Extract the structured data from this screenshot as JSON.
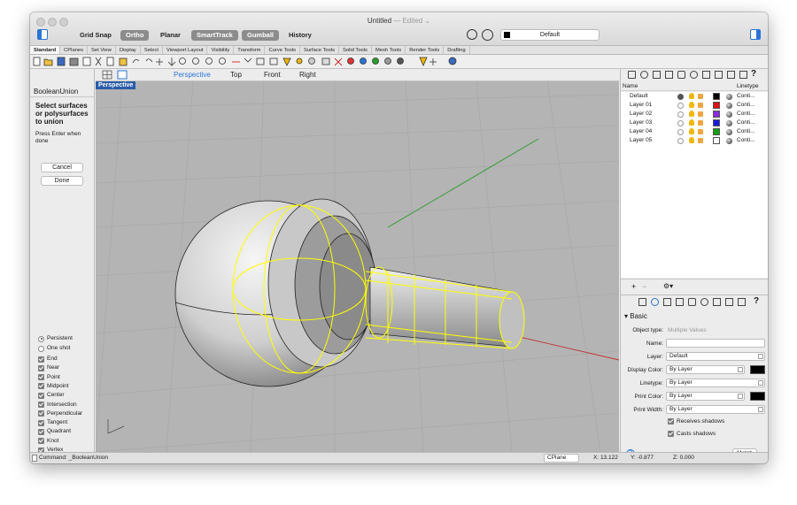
{
  "window": {
    "title": "Untitled",
    "edited": "— Edited ⌄"
  },
  "toolbar": {
    "grid_snap": "Grid Snap",
    "ortho": "Ortho",
    "planar": "Planar",
    "smarttrack": "SmartTrack",
    "gumball": "Gumball",
    "history": "History",
    "current_layer": "Default"
  },
  "tabs": [
    "Standard",
    "CPlanes",
    "Set View",
    "Display",
    "Select",
    "Viewport Layout",
    "Visibility",
    "Transform",
    "Curve Tools",
    "Surface Tools",
    "Solid Tools",
    "Mesh Tools",
    "Render Tools",
    "Drafting"
  ],
  "command_panel": {
    "name": "BooleanUnion",
    "prompt": "Select surfaces or polysurfaces to union",
    "hint": "Press Enter when done",
    "cancel": "Cancel",
    "done": "Done"
  },
  "osnap": {
    "persistent": "Persistent",
    "one_shot": "One shot",
    "items": [
      "End",
      "Near",
      "Point",
      "Midpoint",
      "Center",
      "Intersection",
      "Perpendicular",
      "Tangent",
      "Quadrant",
      "Knot",
      "Vertex"
    ]
  },
  "viewports": {
    "tabs": [
      "Perspective",
      "Top",
      "Front",
      "Right"
    ],
    "active_label": "Perspective"
  },
  "layers": {
    "col_name": "Name",
    "col_linetype": "Linetype",
    "rows": [
      {
        "name": "Default",
        "color": "#000000",
        "linetype": "Conti..."
      },
      {
        "name": "Layer 01",
        "color": "#e01010",
        "linetype": "Conti..."
      },
      {
        "name": "Layer 02",
        "color": "#8a2be2",
        "linetype": "Conti..."
      },
      {
        "name": "Layer 03",
        "color": "#1a1adc",
        "linetype": "Conti..."
      },
      {
        "name": "Layer 04",
        "color": "#10a010",
        "linetype": "Conti..."
      },
      {
        "name": "Layer 05",
        "color": "#ffffff",
        "linetype": "Conti..."
      }
    ]
  },
  "properties": {
    "section": "Basic",
    "object_type_label": "Object type:",
    "object_type_value": "Multiple Values",
    "name_label": "Name:",
    "layer_label": "Layer:",
    "layer_value": "Default",
    "display_color_label": "Display Color:",
    "display_color_value": "By Layer",
    "linetype_label": "Linetype:",
    "linetype_value": "By Layer",
    "print_color_label": "Print Color:",
    "print_color_value": "By Layer",
    "print_width_label": "Print Width:",
    "print_width_value": "By Layer",
    "receives_shadows": "Receives shadows",
    "casts_shadows": "Casts shadows",
    "match": "Match",
    "help": "?"
  },
  "status": {
    "command": "Command: _BooleanUnion",
    "cplane": "CPlane",
    "x": "X: 13.122",
    "y": "Y: -0.877",
    "z": "Z: 0.000"
  },
  "colors": {
    "accent": "#2a74d8",
    "highlight": "#ffff00",
    "viewport_bg": "#b4b4b4"
  }
}
